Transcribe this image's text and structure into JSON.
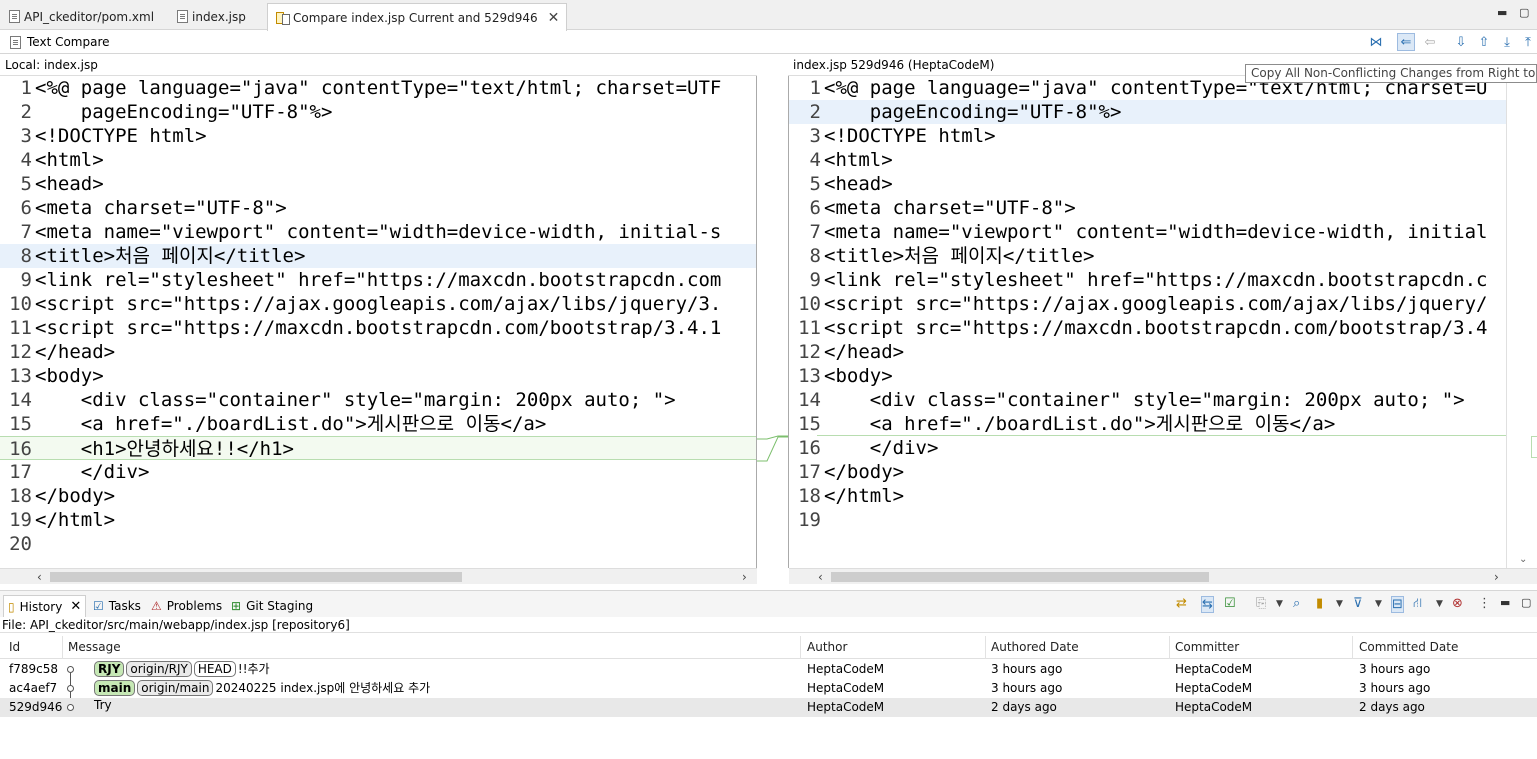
{
  "editor_tabs": [
    {
      "label": "API_ckeditor/pom.xml"
    },
    {
      "label": "index.jsp"
    },
    {
      "label": "Compare index.jsp Current and 529d946"
    }
  ],
  "compare_title": "Text Compare",
  "tooltip": "Copy All Non-Conflicting Changes from Right to Left",
  "left_pane": {
    "header": "Local: index.jsp",
    "lines": [
      {
        "n": "1",
        "text": "<%@ page language=\"java\" contentType=\"text/html; charset=UTF"
      },
      {
        "n": "2",
        "text": "    pageEncoding=\"UTF-8\"%>"
      },
      {
        "n": "3",
        "text": "<!DOCTYPE html>"
      },
      {
        "n": "4",
        "text": "<html>"
      },
      {
        "n": "5",
        "text": "<head>"
      },
      {
        "n": "6",
        "text": "<meta charset=\"UTF-8\">"
      },
      {
        "n": "7",
        "text": "<meta name=\"viewport\" content=\"width=device-width, initial-s"
      },
      {
        "n": "8",
        "text": "<title>처음 페이지</title>"
      },
      {
        "n": "9",
        "text": "<link rel=\"stylesheet\" href=\"https://maxcdn.bootstrapcdn.com"
      },
      {
        "n": "10",
        "text": "<script src=\"https://ajax.googleapis.com/ajax/libs/jquery/3."
      },
      {
        "n": "11",
        "text": "<script src=\"https://maxcdn.bootstrapcdn.com/bootstrap/3.4.1"
      },
      {
        "n": "12",
        "text": "</head>"
      },
      {
        "n": "13",
        "text": "<body>"
      },
      {
        "n": "14",
        "text": "    <div class=\"container\" style=\"margin: 200px auto; \">"
      },
      {
        "n": "15",
        "text": "    <a href=\"./boardList.do\">게시판으로 이동</a>"
      },
      {
        "n": "16",
        "text": "    <h1>안녕하세요!!</h1>"
      },
      {
        "n": "17",
        "text": "    </div>"
      },
      {
        "n": "18",
        "text": "</body>"
      },
      {
        "n": "19",
        "text": "</html>"
      },
      {
        "n": "20",
        "text": ""
      }
    ]
  },
  "right_pane": {
    "header": "index.jsp 529d946 (HeptaCodeM)",
    "lines": [
      {
        "n": "1",
        "text": "<%@ page language=\"java\" contentType=\"text/html; charset=U"
      },
      {
        "n": "2",
        "text": "    pageEncoding=\"UTF-8\"%>"
      },
      {
        "n": "3",
        "text": "<!DOCTYPE html>"
      },
      {
        "n": "4",
        "text": "<html>"
      },
      {
        "n": "5",
        "text": "<head>"
      },
      {
        "n": "6",
        "text": "<meta charset=\"UTF-8\">"
      },
      {
        "n": "7",
        "text": "<meta name=\"viewport\" content=\"width=device-width, initial"
      },
      {
        "n": "8",
        "text": "<title>처음 페이지</title>"
      },
      {
        "n": "9",
        "text": "<link rel=\"stylesheet\" href=\"https://maxcdn.bootstrapcdn.c"
      },
      {
        "n": "10",
        "text": "<script src=\"https://ajax.googleapis.com/ajax/libs/jquery/"
      },
      {
        "n": "11",
        "text": "<script src=\"https://maxcdn.bootstrapcdn.com/bootstrap/3.4"
      },
      {
        "n": "12",
        "text": "</head>"
      },
      {
        "n": "13",
        "text": "<body>"
      },
      {
        "n": "14",
        "text": "    <div class=\"container\" style=\"margin: 200px auto; \">"
      },
      {
        "n": "15",
        "text": "    <a href=\"./boardList.do\">게시판으로 이동</a>"
      },
      {
        "n": "16",
        "text": "    </div>"
      },
      {
        "n": "17",
        "text": "</body>"
      },
      {
        "n": "18",
        "text": "</html>"
      },
      {
        "n": "19",
        "text": ""
      }
    ]
  },
  "bottom_tabs": [
    {
      "label": "History"
    },
    {
      "label": "Tasks"
    },
    {
      "label": "Problems"
    },
    {
      "label": "Git Staging"
    }
  ],
  "history": {
    "file": "File: API_ckeditor/src/main/webapp/index.jsp [repository6]",
    "columns": {
      "id": "Id",
      "message": "Message",
      "author": "Author",
      "authored_date": "Authored Date",
      "committer": "Committer",
      "committed_date": "Committed Date"
    },
    "rows": [
      {
        "id": "f789c58",
        "tags": [
          "RJY",
          "origin/RJY",
          "HEAD"
        ],
        "message": "!!추가",
        "author": "HeptaCodeM",
        "authored_date": "3 hours ago",
        "committer": "HeptaCodeM",
        "committed_date": "3 hours ago"
      },
      {
        "id": "ac4aef7",
        "tags": [
          "main",
          "origin/main"
        ],
        "message": "20240225 index.jsp에 안녕하세요 추가",
        "author": "HeptaCodeM",
        "authored_date": "3 hours ago",
        "committer": "HeptaCodeM",
        "committed_date": "3 hours ago"
      },
      {
        "id": "529d946",
        "tags": [],
        "message": "Try",
        "author": "HeptaCodeM",
        "authored_date": "2 days ago",
        "committer": "HeptaCodeM",
        "committed_date": "2 days ago"
      }
    ]
  },
  "colors": {
    "local_branch": "#c6e8b5",
    "diff_green": "#b8ddb0",
    "line_blue": "#e8f1fb",
    "accent": "#2a6fb0"
  }
}
